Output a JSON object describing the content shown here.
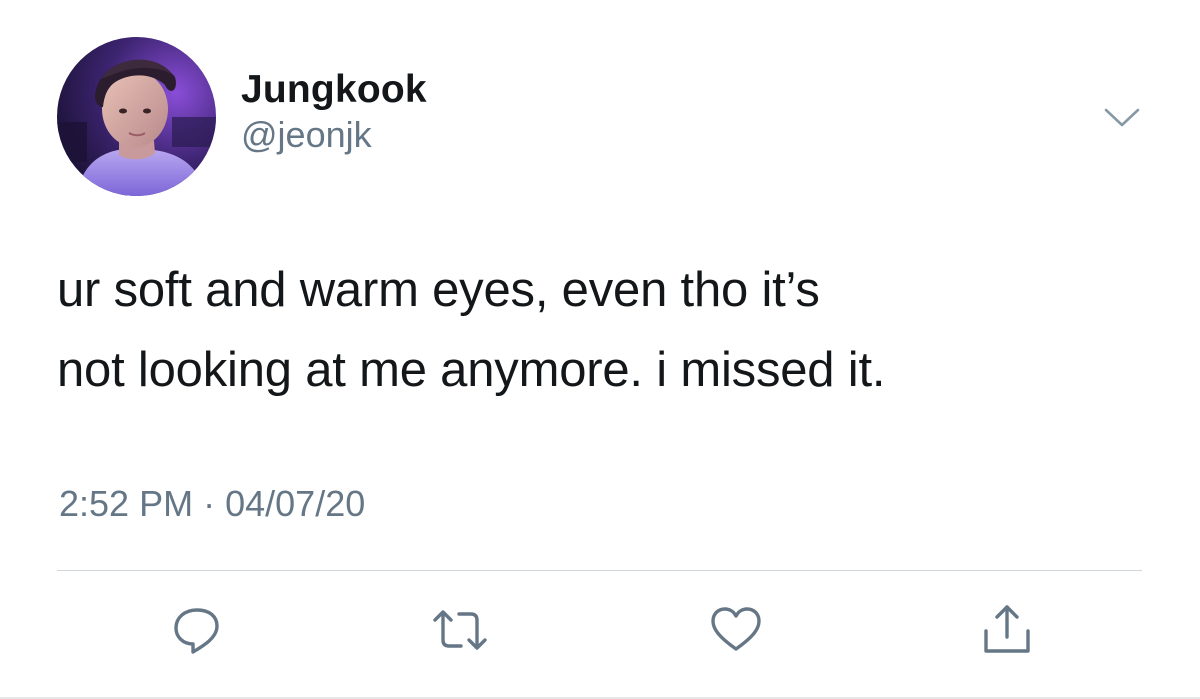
{
  "author": {
    "display_name": "Jungkook",
    "handle": "@jeonjk",
    "avatar": "profile-photo"
  },
  "tweet": {
    "text_lines": [
      "ur soft and warm eyes, even tho it’s",
      "not looking at me anymore. i missed it."
    ],
    "time": "2:52 PM",
    "separator": "·",
    "date": "04/07/20"
  },
  "icons": {
    "caret": "chevron-down-icon",
    "reply": "reply-icon",
    "retweet": "retweet-icon",
    "like": "heart-icon",
    "share": "share-icon"
  },
  "colors": {
    "text": "#14171a",
    "secondary": "#657786",
    "divider": "#cfd5da",
    "background": "#ffffff"
  }
}
